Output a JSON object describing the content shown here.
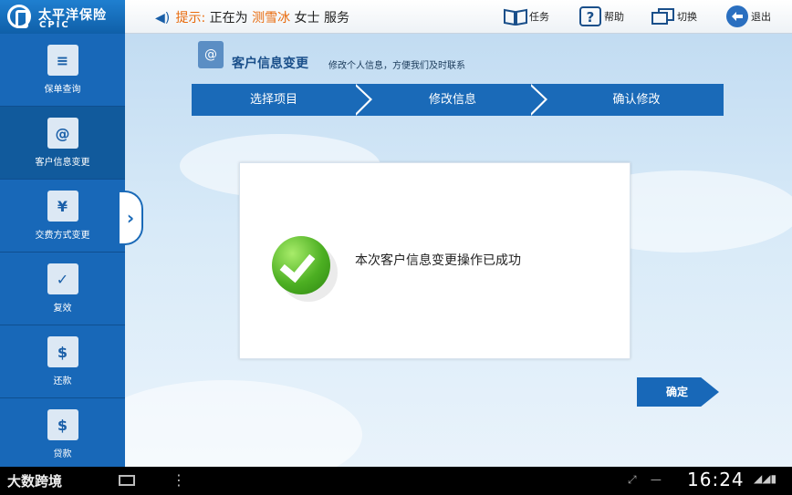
{
  "app": {
    "logo_cn": "太平洋保险",
    "logo_en": "CPIC"
  },
  "topbar": {
    "hint_label": "提示:",
    "hint_prefix": "正在为",
    "customer_name": "测雪冰",
    "hint_suffix": "女士 服务",
    "buttons": [
      {
        "label": "任务",
        "icon": "book-icon"
      },
      {
        "label": "帮助",
        "icon": "help-icon"
      },
      {
        "label": "切换",
        "icon": "switch-icon"
      },
      {
        "label": "退出",
        "icon": "exit-icon"
      }
    ]
  },
  "sidebar": {
    "items": [
      {
        "label": "保单查询",
        "icon": "policy-search-icon",
        "active": false
      },
      {
        "label": "客户信息变更",
        "icon": "customer-info-icon",
        "active": true
      },
      {
        "label": "交费方式变更",
        "icon": "payment-bag-icon",
        "active": false
      },
      {
        "label": "复效",
        "icon": "reinstate-icon",
        "active": false
      },
      {
        "label": "还款",
        "icon": "repay-icon",
        "active": false
      },
      {
        "label": "贷款",
        "icon": "loan-icon",
        "active": false
      }
    ]
  },
  "page": {
    "title": "客户信息变更",
    "subtitle": "修改个人信息，方便我们及时联系",
    "steps": [
      "选择项目",
      "修改信息",
      "确认修改"
    ],
    "message": "本次客户信息变更操作已成功",
    "confirm_label": "确定"
  },
  "statusbar": {
    "watermark": "大数跨境",
    "clock": "16:24"
  },
  "colors": {
    "primary": "#1868b8",
    "accent": "#e86a0c",
    "success": "#4caf22"
  }
}
